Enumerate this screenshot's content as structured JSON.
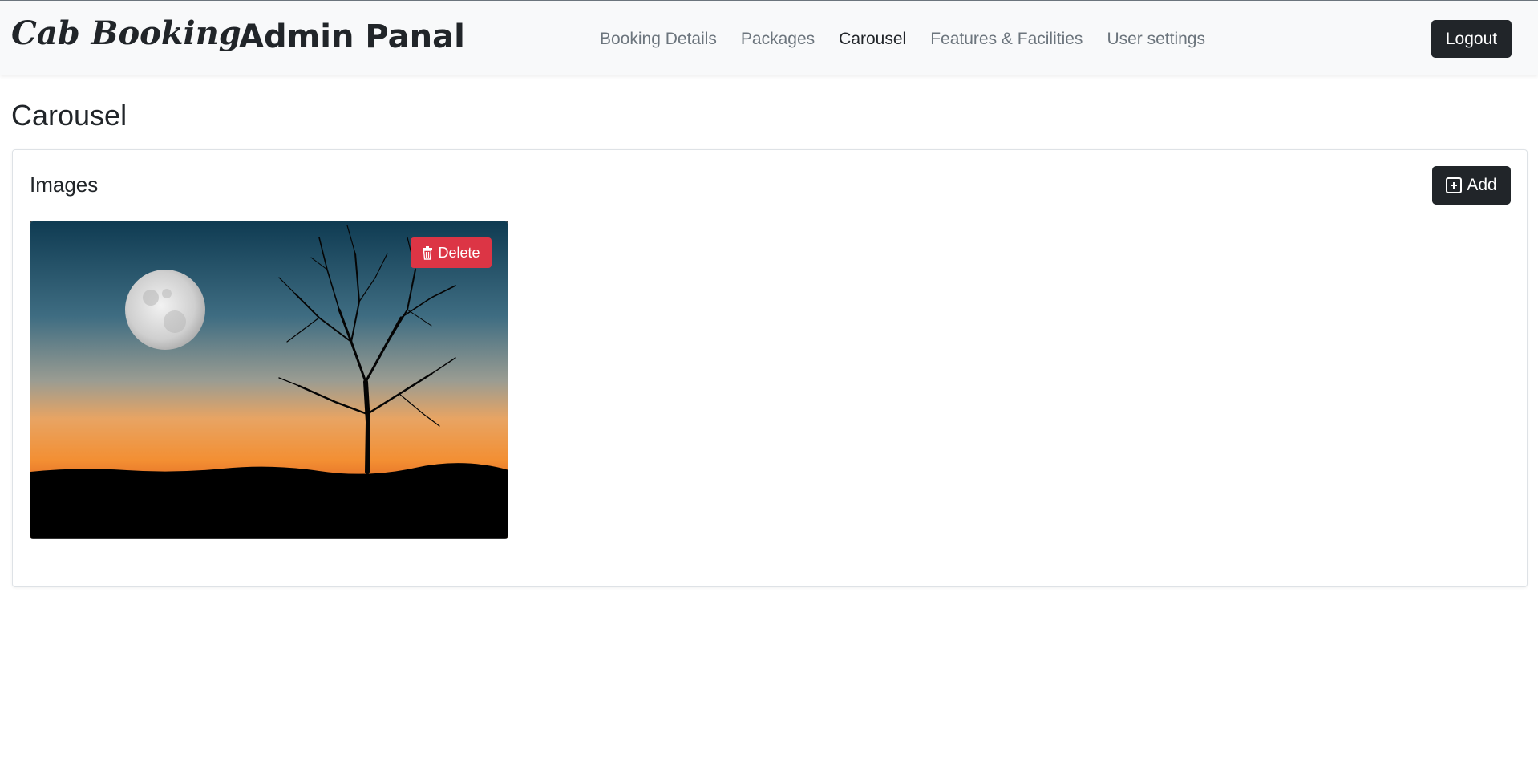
{
  "navbar": {
    "brand": "Cab Booking",
    "title": "Admin Panal",
    "links": [
      {
        "label": "Booking Details",
        "active": false
      },
      {
        "label": "Packages",
        "active": false
      },
      {
        "label": "Carousel",
        "active": true
      },
      {
        "label": "Features & Facilities",
        "active": false
      },
      {
        "label": "User settings",
        "active": false
      }
    ],
    "logout_label": "Logout"
  },
  "page": {
    "title": "Carousel"
  },
  "images_card": {
    "title": "Images",
    "add_label": "Add",
    "add_icon": "plus-square-icon",
    "items": [
      {
        "image": "moon-tree-sunset-image",
        "delete_label": "Delete",
        "delete_icon": "trash-icon"
      }
    ]
  },
  "colors": {
    "navbar_bg": "#f8f9fa",
    "dark_button": "#212529",
    "danger": "#dc3545",
    "muted_link": "#6c757d"
  }
}
